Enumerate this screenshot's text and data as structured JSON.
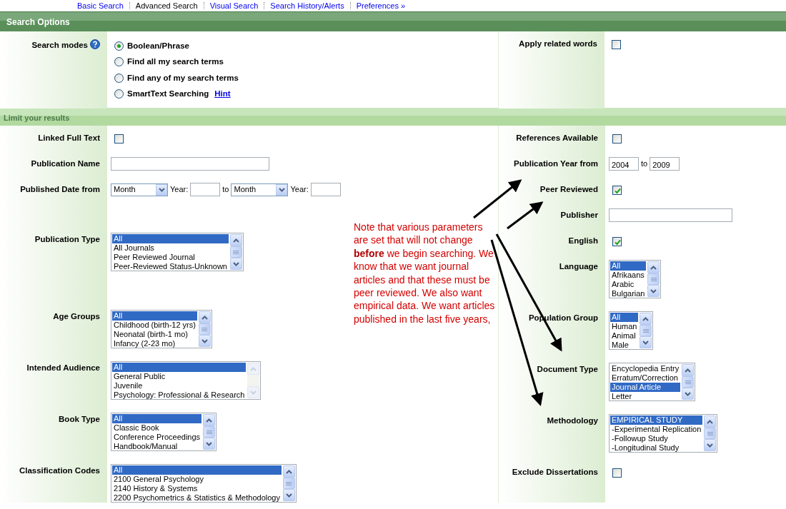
{
  "nav_links": [
    {
      "label": "Basic Search",
      "selected": false
    },
    {
      "label": "Advanced Search",
      "selected": true
    },
    {
      "label": "Visual Search",
      "selected": false
    },
    {
      "label": "Search History/Alerts",
      "selected": false
    },
    {
      "label": "Preferences »",
      "selected": false
    }
  ],
  "search_options": {
    "title": "Search Options",
    "search_modes": {
      "label": "Search modes",
      "options": [
        {
          "label": "Boolean/Phrase",
          "selected": true
        },
        {
          "label": "Find all my search terms",
          "selected": false
        },
        {
          "label": "Find any of my search terms",
          "selected": false
        },
        {
          "label": "SmartText Searching",
          "selected": false,
          "link": "Hint"
        }
      ]
    },
    "related_words": {
      "label": "Apply related words",
      "checked": false
    }
  },
  "limit_results": {
    "title": "Limit your results",
    "left": [
      {
        "kind": "checkbox",
        "label": "Linked Full Text",
        "checked": false
      },
      {
        "kind": "text",
        "label": "Publication Name"
      },
      {
        "kind": "date_range",
        "label": "Published Date from",
        "from_month": "Month",
        "from_year_label": "Year:",
        "to_label": "to",
        "to_month": "Month",
        "to_year_label": "Year:"
      },
      {
        "kind": "listbox",
        "label": "Publication Type",
        "scrollbar_disabled": false,
        "options": [
          {
            "label": "All",
            "selected": true
          },
          {
            "label": "All Journals",
            "selected": false
          },
          {
            "label": "Peer Reviewed Journal",
            "selected": false
          },
          {
            "label": "Peer-Reviewed Status-Unknown",
            "selected": false
          }
        ]
      },
      {
        "kind": "listbox",
        "label": "Age Groups",
        "scrollbar_disabled": false,
        "options": [
          {
            "label": "All",
            "selected": true
          },
          {
            "label": "Childhood (birth-12 yrs)",
            "selected": false
          },
          {
            "label": "Neonatal (birth-1 mo)",
            "selected": false
          },
          {
            "label": "Infancy (2-23 mo)",
            "selected": false
          }
        ]
      },
      {
        "kind": "listbox",
        "label": "Intended Audience",
        "scrollbar_disabled": true,
        "options": [
          {
            "label": "All",
            "selected": true
          },
          {
            "label": "General Public",
            "selected": false
          },
          {
            "label": "Juvenile",
            "selected": false
          },
          {
            "label": "Psychology: Professional & Research",
            "selected": false
          }
        ]
      },
      {
        "kind": "listbox",
        "label": "Book Type",
        "scrollbar_disabled": false,
        "options": [
          {
            "label": "All",
            "selected": true
          },
          {
            "label": "Classic Book",
            "selected": false
          },
          {
            "label": "Conference Proceedings",
            "selected": false
          },
          {
            "label": "Handbook/Manual",
            "selected": false
          }
        ]
      },
      {
        "kind": "listbox",
        "label": "Classification Codes",
        "scrollbar_disabled": false,
        "options": [
          {
            "label": "All",
            "selected": true
          },
          {
            "label": "2100 General Psychology",
            "selected": false
          },
          {
            "label": "2140 History & Systems",
            "selected": false
          },
          {
            "label": "2200 Psychometrics & Statistics & Methodology",
            "selected": false
          }
        ]
      }
    ],
    "right": [
      {
        "kind": "checkbox",
        "label": "References Available",
        "checked": false
      },
      {
        "kind": "year_range",
        "label": "Publication Year from",
        "from": "2004",
        "to_label": "to",
        "to": "2009"
      },
      {
        "kind": "checkbox",
        "label": "Peer Reviewed",
        "checked": true
      },
      {
        "kind": "text",
        "label": "Publisher"
      },
      {
        "kind": "checkbox",
        "label": "English",
        "checked": true
      },
      {
        "kind": "listbox",
        "label": "Language",
        "scrollbar_disabled": false,
        "options": [
          {
            "label": "All",
            "selected": true
          },
          {
            "label": "Afrikaans",
            "selected": false
          },
          {
            "label": "Arabic",
            "selected": false
          },
          {
            "label": "Bulgarian",
            "selected": false
          }
        ]
      },
      {
        "kind": "listbox",
        "label": "Population Group",
        "scrollbar_disabled": false,
        "options": [
          {
            "label": "All",
            "selected": true
          },
          {
            "label": "Human",
            "selected": false
          },
          {
            "label": "Animal",
            "selected": false
          },
          {
            "label": "Male",
            "selected": false
          }
        ]
      },
      {
        "kind": "listbox",
        "label": "Document Type",
        "scrollbar_disabled": false,
        "options": [
          {
            "label": "Encyclopedia Entry",
            "selected": false
          },
          {
            "label": "Erratum/Correction",
            "selected": false
          },
          {
            "label": "Journal Article",
            "selected": true
          },
          {
            "label": "Letter",
            "selected": false
          }
        ]
      },
      {
        "kind": "listbox",
        "label": "Methodology",
        "scrollbar_disabled": false,
        "options": [
          {
            "label": "EMPIRICAL STUDY",
            "selected": true
          },
          {
            "label": "-Experimental Replication",
            "selected": false
          },
          {
            "label": "-Followup Study",
            "selected": false
          },
          {
            "label": "-Longitudinal Study",
            "selected": false
          }
        ]
      },
      {
        "kind": "checkbox",
        "label": "Exclude Dissertations",
        "checked": false
      }
    ]
  },
  "annotation": {
    "text": "Note that various parameters are set that will not change **before** we begin searching. We know that we want journal articles and that these must be peer reviewed. We also want empirical data. We want articles published in the last five years,"
  }
}
